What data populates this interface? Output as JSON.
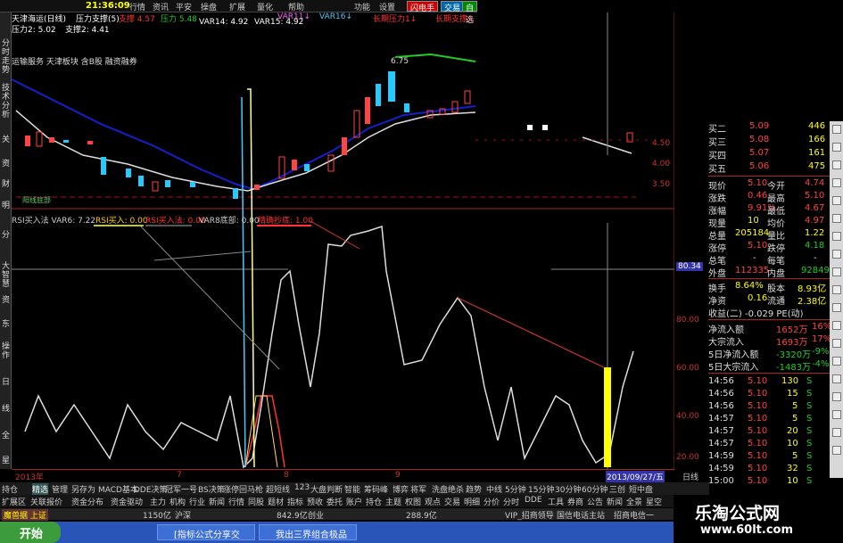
{
  "menu": {
    "clock": "21:36:09",
    "items": [
      "行情",
      "资讯",
      "平安",
      "操盘",
      "扩展",
      "量化",
      "帮助",
      "功能",
      "设置"
    ],
    "buttons": [
      "闪电手",
      "交易",
      "自选"
    ]
  },
  "left_tabs": [
    "分时走势",
    "技术分析",
    "关",
    "资",
    "财",
    "明",
    "分",
    "大智慧",
    "资",
    "东",
    "操作",
    "日",
    "线",
    "全",
    "星"
  ],
  "chart": {
    "title": "天津海运(日线)",
    "subtitle": "压力支撑(5)",
    "ind1": [
      {
        "t": "支撑 4.57",
        "c": "#f33"
      },
      {
        "t": "压力 5.48",
        "c": "#2c2"
      },
      {
        "t": "VAR11↓",
        "c": "#f6f"
      },
      {
        "t": "VAR16↓",
        "c": "#4cf"
      },
      {
        "t": "长期压力1↓",
        "c": "#f33"
      },
      {
        "t": "长期支撑↓",
        "c": "#f33"
      }
    ],
    "ind2": [
      "压力2: 5.02",
      "支撑2: 4.41",
      "VAR14: 4.92",
      "VAR15: 4.92"
    ],
    "stock_info": "运输服务 天津板块 含B股 融资融券",
    "tag_low": "阳线底部",
    "price_high": "6.75",
    "rsi_legend": [
      {
        "t": "RSI买入法 VAR6: 7.22",
        "c": "#ccc"
      },
      {
        "t": "RSI买入: 0.00",
        "c": "#fc0"
      },
      {
        "t": "RSI买入法: 0.00",
        "c": "#f33"
      },
      {
        "t": "VAR8底部: 0.00",
        "c": "#ccc"
      },
      {
        "t": "精确抄底: 1.00",
        "c": "#f33"
      }
    ],
    "price_scale": [
      "4.50",
      "4.00",
      "3.50"
    ],
    "rsi_scale": [
      "80.00",
      "60.00",
      "40.00",
      "20.00"
    ],
    "crosshair_value": "80.34",
    "dates": [
      "2013年",
      "7",
      "8",
      "9",
      "2013/09/27/五",
      "日线"
    ]
  },
  "quote": {
    "asks": [
      {
        "l": "买二",
        "p": "5.09",
        "v": "446"
      },
      {
        "l": "买三",
        "p": "5.08",
        "v": "166"
      },
      {
        "l": "买四",
        "p": "5.07",
        "v": "161"
      },
      {
        "l": "买五",
        "p": "5.06",
        "v": "475"
      }
    ],
    "stats": [
      {
        "l": "现价",
        "v": "5.10",
        "l2": "今开",
        "v2": "4.74"
      },
      {
        "l": "涨跌",
        "v": "0.46",
        "l2": "最高",
        "v2": "5.10"
      },
      {
        "l": "涨幅",
        "v": "9.91%",
        "l2": "最低",
        "v2": "4.67"
      },
      {
        "l": "现量",
        "v": "10",
        "l2": "均价",
        "v2": "4.97"
      },
      {
        "l": "总量",
        "v": "205184",
        "l2": "量比",
        "v2": "1.22"
      },
      {
        "l": "涨停",
        "v": "5.10",
        "l2": "跌停",
        "v2": "4.18"
      },
      {
        "l": "总笔",
        "v": "-",
        "l2": "每笔",
        "v2": "-"
      },
      {
        "l": "外盘",
        "v": "112335",
        "l2": "内盘",
        "v2": "92849"
      },
      {
        "l": "换手",
        "v": "8.64%",
        "l2": "股本",
        "v2": "8.93亿"
      },
      {
        "l": "净资",
        "v": "0.16",
        "l2": "流通",
        "v2": "2.38亿"
      }
    ],
    "income": "收益(二) -0.029 PE(动)",
    "flows": [
      {
        "l": "净流入额",
        "v": "1652万",
        "p": "16%"
      },
      {
        "l": "大宗流入",
        "v": "1693万",
        "p": "17%"
      },
      {
        "l": "5日净流入额",
        "v": "-3320万",
        "p": "-9%"
      },
      {
        "l": "5日大宗流入",
        "v": "-1483万",
        "p": "-4%"
      }
    ],
    "ticks": [
      {
        "t": "14:56",
        "p": "5.10",
        "v": "130",
        "d": "S"
      },
      {
        "t": "14:56",
        "p": "5.10",
        "v": "15",
        "d": "S"
      },
      {
        "t": "14:56",
        "p": "5.10",
        "v": "5",
        "d": "S"
      },
      {
        "t": "14:57",
        "p": "5.10",
        "v": "5",
        "d": "S"
      },
      {
        "t": "14:57",
        "p": "5.10",
        "v": "20",
        "d": "S"
      },
      {
        "t": "14:57",
        "p": "5.10",
        "v": "10",
        "d": "S"
      },
      {
        "t": "14:59",
        "p": "5.10",
        "v": "5",
        "d": "S"
      },
      {
        "t": "14:59",
        "p": "5.10",
        "v": "32",
        "d": "S"
      },
      {
        "t": "15:00",
        "p": "5.10",
        "v": "10",
        "d": "S"
      }
    ]
  },
  "tabs_row1": [
    "持仓",
    "精选",
    "管理",
    "另存为",
    "MACD基本",
    "DDE决策",
    "冠军一号",
    "BS决策",
    "涨停回马枪",
    "超短线",
    "123",
    "大盘判断",
    "智能",
    "筹码峰",
    "博弈",
    "将军",
    "洗盘绝杀",
    "趋势",
    "中线",
    "5分钟",
    "15分钟",
    "30分钟",
    "60分钟",
    "三创",
    "短中盘"
  ],
  "tabs_row2": [
    "扩展区",
    "关联报价",
    "资金分布",
    "资金驱动",
    "主力",
    "机构",
    "行业",
    "新闻",
    "行情",
    "同股",
    "题材",
    "指标",
    "预收",
    "委托",
    "账户",
    "持仓",
    "主题",
    "权图",
    "观点",
    "交易",
    "明细",
    "分价",
    "分时",
    "DDE",
    "工具",
    "券商",
    "公告",
    "新闻",
    "全景",
    "星空"
  ],
  "status": {
    "items": [
      "魔兽据 上证",
      "1150亿",
      "沪深",
      "842.9亿",
      "创业",
      "288.9亿",
      "VIP_招商领导",
      "国信电话主站",
      "招商电信一"
    ]
  },
  "taskbar": {
    "start": "开始",
    "tasks": [
      "[指标公式分享交",
      "我出三界组合极品"
    ]
  },
  "brand": {
    "name": "乐淘公式网",
    "url": "www.60lt.com"
  }
}
